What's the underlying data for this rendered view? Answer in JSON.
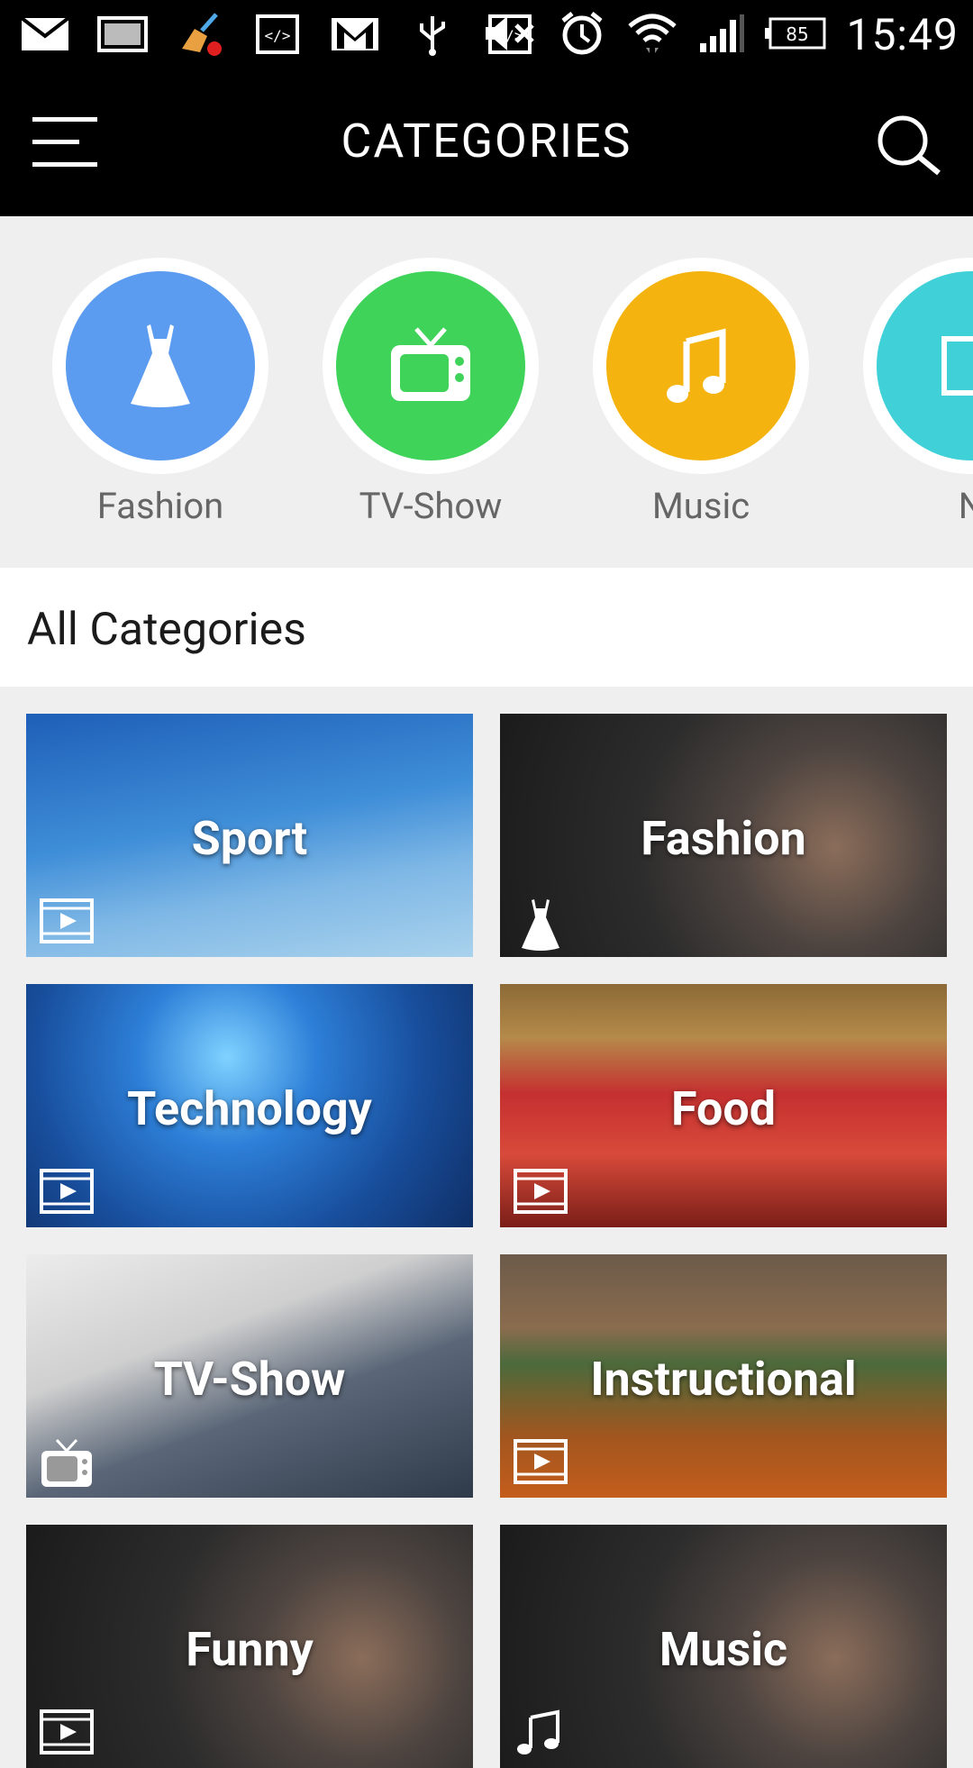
{
  "status_bar": {
    "time": "15:49",
    "battery": "85",
    "left_icons": [
      "mail-icon",
      "image-icon",
      "cleaner-alert-icon",
      "code-icon",
      "gmail-icon",
      "usb-icon",
      "code-icon"
    ],
    "right_icons": [
      "mute-icon",
      "alarm-icon",
      "wifi-icon",
      "signal-icon",
      "battery-icon"
    ]
  },
  "app_bar": {
    "title": "CATEGORIES",
    "menu_icon": "hamburger-menu-icon",
    "search_icon": "search-icon"
  },
  "carousel": {
    "items": [
      {
        "label": "Fashion",
        "icon": "dress-icon",
        "color": "#5b9cf0"
      },
      {
        "label": "TV-Show",
        "icon": "tv-icon",
        "color": "#3fd35a"
      },
      {
        "label": "Music",
        "icon": "music-note-icon",
        "color": "#f5b30f"
      },
      {
        "label": "N",
        "icon": "news-icon",
        "color": "#3fd0d8"
      }
    ]
  },
  "all_categories": {
    "header": "All Categories",
    "tiles": [
      {
        "name": "Sport",
        "badge": "video-icon"
      },
      {
        "name": "Fashion",
        "badge": "dress-icon"
      },
      {
        "name": "Technology",
        "badge": "video-icon"
      },
      {
        "name": "Food",
        "badge": "video-icon"
      },
      {
        "name": "TV-Show",
        "badge": "tv-icon"
      },
      {
        "name": "Instructional",
        "badge": "video-icon"
      },
      {
        "name": "Funny",
        "badge": "video-icon"
      },
      {
        "name": "Music",
        "badge": "music-note-icon"
      }
    ]
  }
}
